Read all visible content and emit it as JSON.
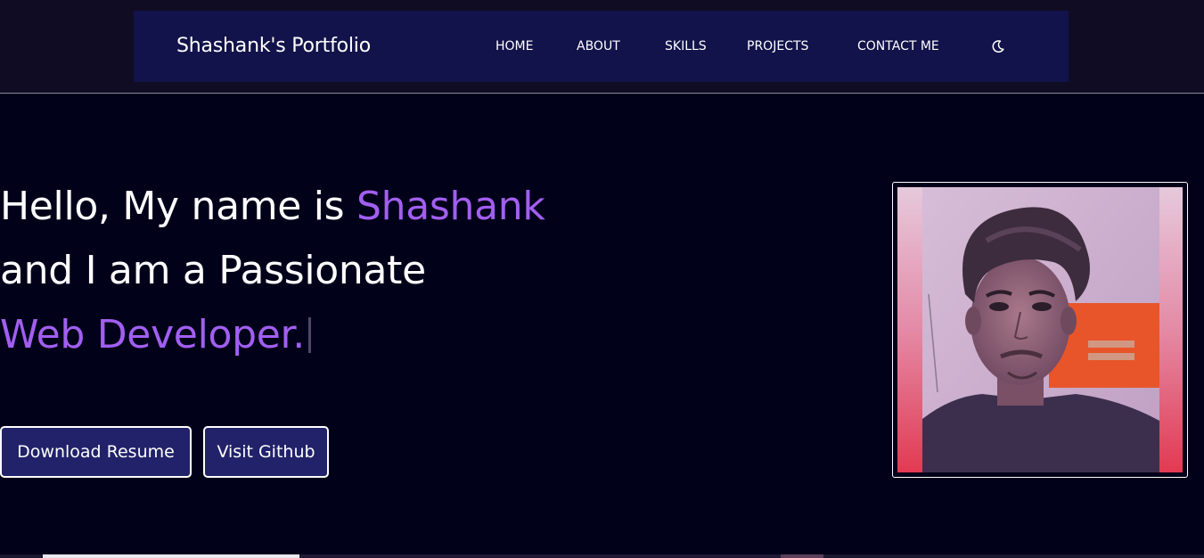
{
  "header": {
    "brand": "Shashank's Portfolio",
    "nav": [
      {
        "label": "HOME"
      },
      {
        "label": "ABOUT"
      },
      {
        "label": "SKILLS"
      },
      {
        "label": "PROJECTS"
      },
      {
        "label": "CONTACT ME"
      }
    ],
    "theme_toggle_icon": "moon-icon"
  },
  "hero": {
    "line1_prefix": "Hello, My name is ",
    "line1_name": "Shashank",
    "line2": "and I am a Passionate",
    "line3": "Web Developer.",
    "buttons": {
      "download": "Download Resume",
      "github": "Visit Github"
    }
  },
  "colors": {
    "accent": "#a15ff0",
    "navbar": "#12134a",
    "background": "#02011a",
    "button": "#21226a"
  }
}
